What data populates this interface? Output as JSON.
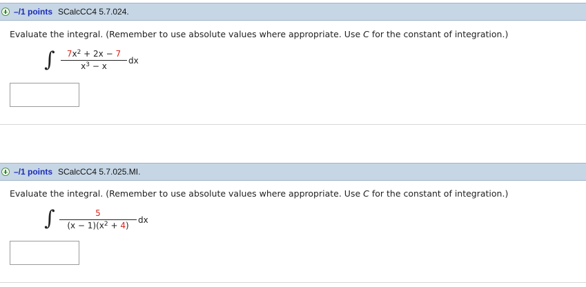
{
  "questions": [
    {
      "points": "–/1 points",
      "id": "SCalcCC4 5.7.024.",
      "prompt_pre": "Evaluate the integral. (Remember to use absolute values where appropriate. Use ",
      "prompt_var": "C",
      "prompt_post": " for the constant of integration.)",
      "integrand": {
        "num_coef": "7",
        "num_x": "x",
        "num_exp": "2",
        "num_mid": " + 2x − ",
        "num_const": "7",
        "den_x": "x",
        "den_exp": "3",
        "den_rest": " − x",
        "dx": "dx"
      },
      "answer_value": ""
    },
    {
      "points": "–/1 points",
      "id": "SCalcCC4 5.7.025.MI.",
      "prompt_pre": "Evaluate the integral. (Remember to use absolute values where appropriate. Use ",
      "prompt_var": "C",
      "prompt_post": " for the constant of integration.)",
      "integrand": {
        "num": "5",
        "den_pre": "(x − 1)(x",
        "den_exp": "2",
        "den_mid": " + ",
        "den_const": "4",
        "den_close": ")",
        "dx": "dx"
      },
      "answer_value": ""
    }
  ],
  "colors": {
    "header_bg": "#c6d6e5",
    "points_text": "#1a2bb8",
    "highlight_red": "#d9241b"
  },
  "icons": {
    "expand": "plus-circle-icon"
  }
}
